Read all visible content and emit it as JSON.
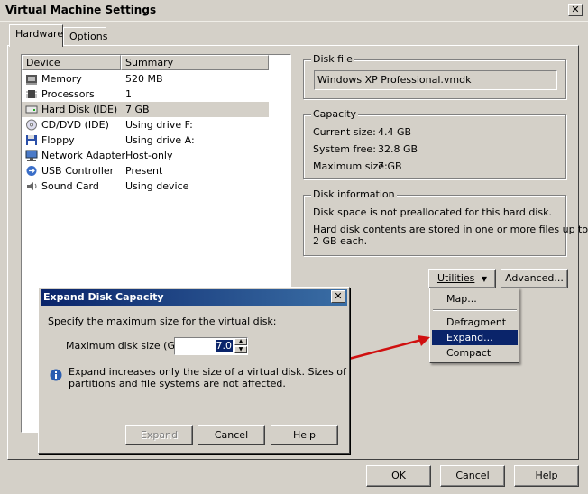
{
  "window": {
    "title": "Virtual Machine Settings",
    "close_glyph": "✕"
  },
  "tabs": [
    {
      "label": "Hardware",
      "active": true
    },
    {
      "label": "Options",
      "active": false
    }
  ],
  "device_list": {
    "columns": [
      "Device",
      "Summary"
    ],
    "rows": [
      {
        "icon": "memory-icon",
        "device": "Memory",
        "summary": "520 MB",
        "selected": false
      },
      {
        "icon": "processor-icon",
        "device": "Processors",
        "summary": "1",
        "selected": false
      },
      {
        "icon": "hard-disk-icon",
        "device": "Hard Disk (IDE)",
        "summary": "7 GB",
        "selected": true
      },
      {
        "icon": "cd-dvd-icon",
        "device": "CD/DVD (IDE)",
        "summary": "Using drive F:",
        "selected": false
      },
      {
        "icon": "floppy-icon",
        "device": "Floppy",
        "summary": "Using drive A:",
        "selected": false
      },
      {
        "icon": "network-adapter-icon",
        "device": "Network Adapter",
        "summary": "Host-only",
        "selected": false
      },
      {
        "icon": "usb-icon",
        "device": "USB Controller",
        "summary": "Present",
        "selected": false
      },
      {
        "icon": "sound-card-icon",
        "device": "Sound Card",
        "summary": "Using device",
        "selected": false
      }
    ]
  },
  "disk_file": {
    "legend": "Disk file",
    "value": "Windows XP Professional.vmdk"
  },
  "capacity": {
    "legend": "Capacity",
    "current_label": "Current size:",
    "current_value": "4.4 GB",
    "free_label": "System free:",
    "free_value": "32.8 GB",
    "max_label": "Maximum size:",
    "max_value": "7 GB"
  },
  "disk_info": {
    "legend": "Disk information",
    "line1": "Disk space is not preallocated for this hard disk.",
    "line2": "Hard disk contents are stored in one or more files up to",
    "line3": "2 GB each."
  },
  "buttons": {
    "utilities": "Utilities",
    "advanced": "Advanced...",
    "ok": "OK",
    "cancel": "Cancel",
    "help": "Help"
  },
  "utilities_menu": {
    "items": [
      {
        "label": "Map...",
        "highlighted": false
      },
      {
        "label": "Defragment",
        "highlighted": false
      },
      {
        "label": "Expand...",
        "highlighted": true
      },
      {
        "label": "Compact",
        "highlighted": false
      }
    ]
  },
  "expand_dialog": {
    "title": "Expand Disk Capacity",
    "close_glyph": "✕",
    "instruction": "Specify the maximum size for the virtual disk:",
    "size_label": "Maximum disk size (GB):",
    "size_value": "7.0",
    "info_line1": "Expand increases only the size of a virtual disk. Sizes of",
    "info_line2": "partitions and file systems are not affected.",
    "expand_button": "Expand",
    "cancel_button": "Cancel",
    "help_button": "Help"
  },
  "colors": {
    "face": "#d4d0c8",
    "highlight": "#0a246a",
    "arrow": "#d01010"
  }
}
